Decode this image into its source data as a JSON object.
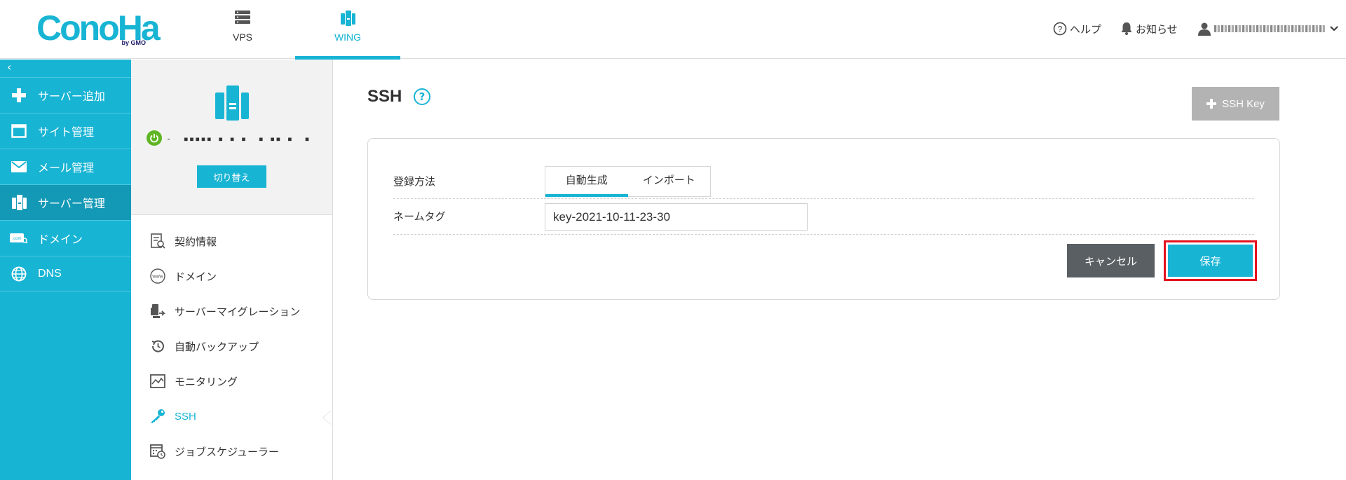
{
  "header": {
    "logo_text": "ConoHa",
    "logo_sub": "by GMO",
    "nav": [
      {
        "label": "VPS",
        "icon": "server-stack-icon"
      },
      {
        "label": "WING",
        "icon": "wing-server-icon"
      }
    ],
    "help_label": "ヘルプ",
    "notice_label": "お知らせ"
  },
  "sidebar": {
    "collapse_glyph": "‹",
    "items": [
      {
        "label": "サーバー追加",
        "icon": "plus-icon"
      },
      {
        "label": "サイト管理",
        "icon": "window-icon"
      },
      {
        "label": "メール管理",
        "icon": "mail-icon"
      },
      {
        "label": "サーバー管理",
        "icon": "server-icon"
      },
      {
        "label": "ドメイン",
        "icon": "domain-icon"
      },
      {
        "label": "DNS",
        "icon": "globe-icon"
      }
    ]
  },
  "subpanel": {
    "server_name_masked": "-  ▪▪▪▪▪ ▪ ▪ ▪  ▪ ▪▪ ▪  ▪",
    "switch_label": "切り替え",
    "items": [
      {
        "label": "契約情報",
        "icon": "contract-icon"
      },
      {
        "label": "ドメイン",
        "icon": "www-icon"
      },
      {
        "label": "サーバーマイグレーション",
        "icon": "migration-icon"
      },
      {
        "label": "自動バックアップ",
        "icon": "backup-icon"
      },
      {
        "label": "モニタリング",
        "icon": "monitoring-icon"
      },
      {
        "label": "SSH",
        "icon": "key-icon"
      },
      {
        "label": "ジョブスケジューラー",
        "icon": "scheduler-icon"
      }
    ]
  },
  "main": {
    "title": "SSH",
    "help_glyph": "?",
    "ssh_key_button": "SSH Key",
    "form": {
      "method_label": "登録方法",
      "tabs": [
        "自動生成",
        "インポート"
      ],
      "nametag_label": "ネームタグ",
      "nametag_value": "key-2021-10-11-23-30",
      "cancel_label": "キャンセル",
      "save_label": "保存"
    }
  },
  "colors": {
    "accent": "#18b4d4",
    "sidebar_active": "#1399b6",
    "highlight_border": "#e4141e",
    "cancel_bg": "#5a5f63",
    "power_on": "#5fb523"
  }
}
